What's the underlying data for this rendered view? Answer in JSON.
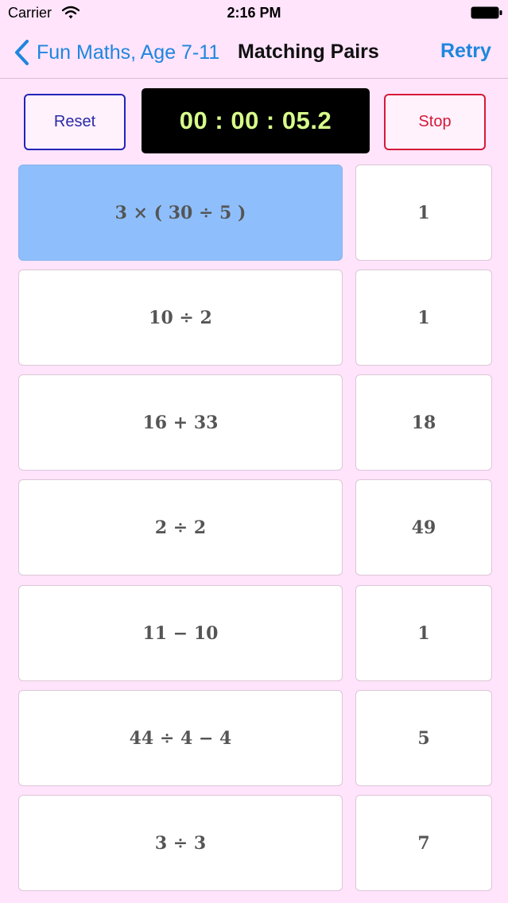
{
  "status_bar": {
    "carrier": "Carrier",
    "time": "2:16 PM"
  },
  "nav": {
    "back_label": "Fun Maths, Age 7-11",
    "title": "Matching Pairs",
    "retry_label": "Retry"
  },
  "controls": {
    "reset_label": "Reset",
    "timer": "00 : 00 : 05.2",
    "stop_label": "Stop"
  },
  "colors": {
    "background": "#ffe4fb",
    "accent": "#1e86de",
    "selected_card": "#8ebffc",
    "timer_text": "#d8ff8a",
    "reset_border": "#2323b8",
    "stop_border": "#d51a3a"
  },
  "expressions": [
    {
      "text": "3 × ( 30 ÷ 5 )",
      "selected": true
    },
    {
      "text": "10 ÷ 2",
      "selected": false
    },
    {
      "text": "16 + 33",
      "selected": false
    },
    {
      "text": "2 ÷ 2",
      "selected": false
    },
    {
      "text": "11 − 10",
      "selected": false
    },
    {
      "text": "44 ÷ 4 − 4",
      "selected": false
    },
    {
      "text": "3 ÷ 3",
      "selected": false
    }
  ],
  "answers": [
    {
      "text": "1"
    },
    {
      "text": "1"
    },
    {
      "text": "18"
    },
    {
      "text": "49"
    },
    {
      "text": "1"
    },
    {
      "text": "5"
    },
    {
      "text": "7"
    }
  ]
}
